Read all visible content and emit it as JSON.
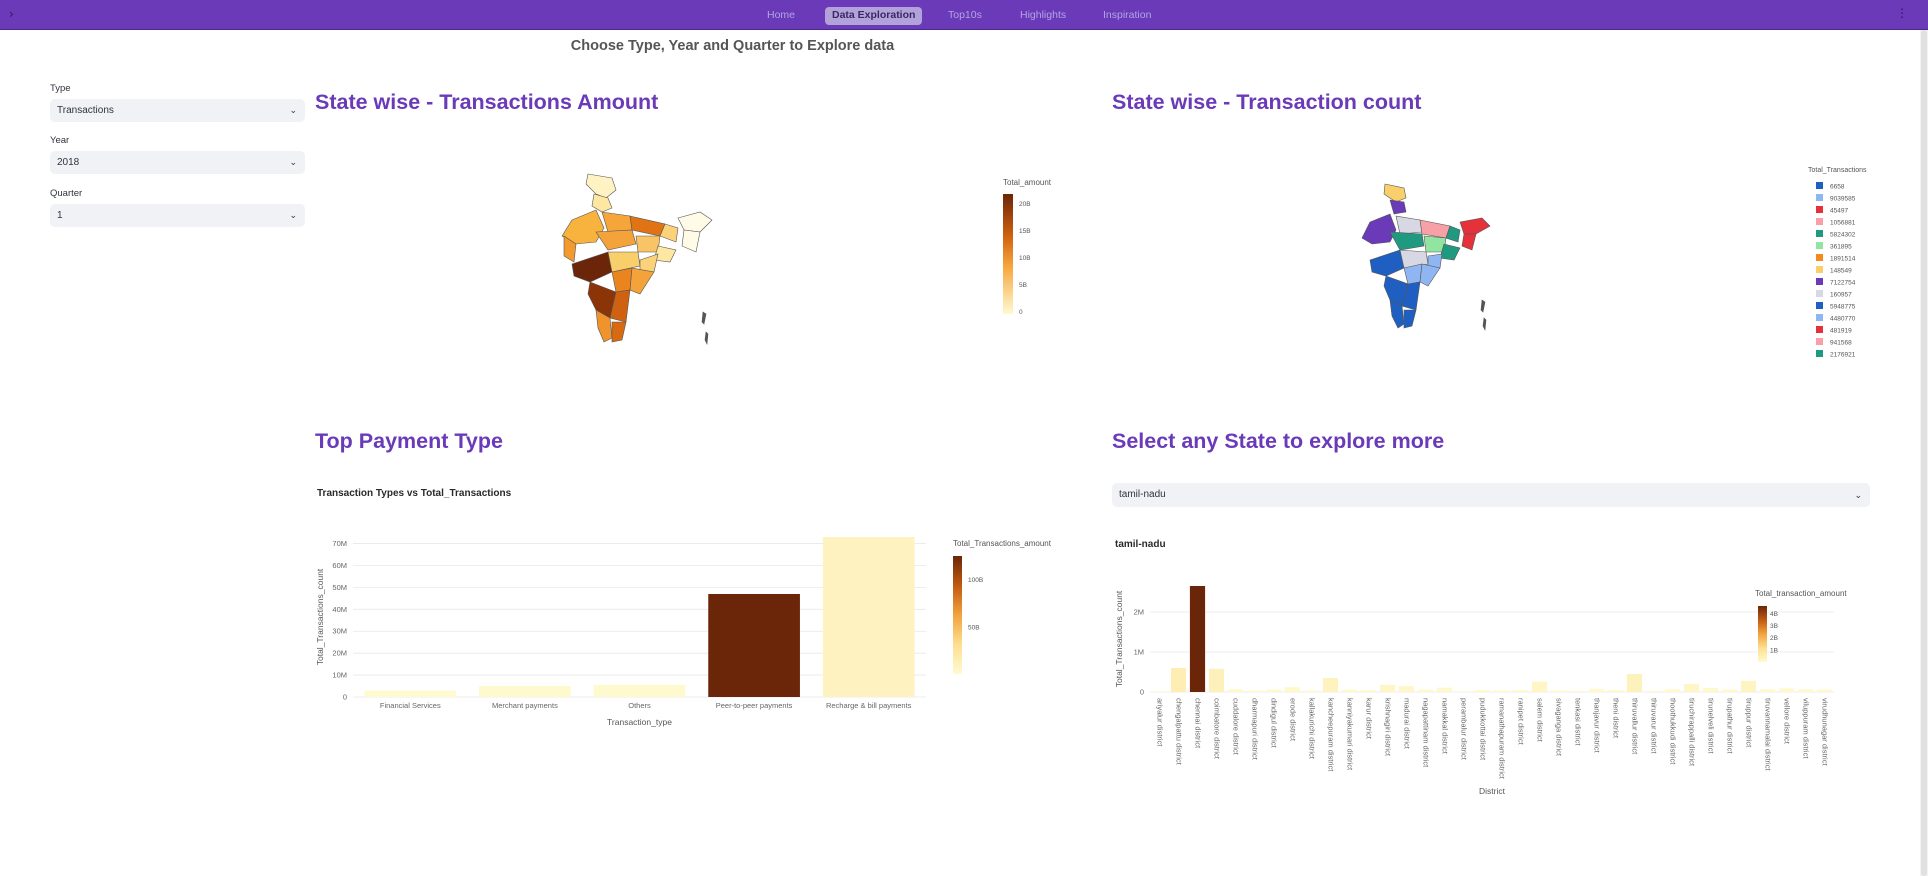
{
  "nav": {
    "toggle_icon": "chevron-right-icon",
    "menu_icon": "kebab-menu-icon",
    "items": [
      "Home",
      "Data Exploration",
      "Top10s",
      "Highlights",
      "Inspiration"
    ],
    "active_index": 1
  },
  "page": {
    "title": "Choose Type, Year and Quarter to Explore data"
  },
  "sidebar": {
    "type_label": "Type",
    "type_value": "Transactions",
    "year_label": "Year",
    "year_value": "2018",
    "quarter_label": "Quarter",
    "quarter_value": "1"
  },
  "sections": {
    "amount_title": "State wise - Transactions Amount",
    "count_title": "State wise - Transaction count",
    "payment_title": "Top Payment Type",
    "state_title": "Select any State to explore more",
    "state_select_value": "tamil-nadu"
  },
  "colors": {
    "accent": "#6a3ab9",
    "scale_high": "#6b2508",
    "scale_low": "#fffad0"
  },
  "maps": {
    "amount_map": {
      "colorbar_title": "Total_amount",
      "ticks": [
        "20B",
        "15B",
        "10B",
        "5B",
        "0"
      ]
    },
    "count_map": {
      "legend_title": "Total_Transactions",
      "entries": [
        {
          "label": "6658",
          "color": "#1f5fc2"
        },
        {
          "label": "9039585",
          "color": "#8fb6f2"
        },
        {
          "label": "45497",
          "color": "#e4313a"
        },
        {
          "label": "1056881",
          "color": "#f7a1a6"
        },
        {
          "label": "5824302",
          "color": "#1f9a80"
        },
        {
          "label": "361895",
          "color": "#91e5a1"
        },
        {
          "label": "1891514",
          "color": "#f28a1e"
        },
        {
          "label": "148549",
          "color": "#f9cf6b"
        },
        {
          "label": "7122754",
          "color": "#6a3ab9"
        },
        {
          "label": "160957",
          "color": "#d8d8e4"
        },
        {
          "label": "5948775",
          "color": "#1f5fc2"
        },
        {
          "label": "4480770",
          "color": "#8fb6f2"
        },
        {
          "label": "481919",
          "color": "#e4313a"
        },
        {
          "label": "941568",
          "color": "#f7a1a6"
        },
        {
          "label": "2176921",
          "color": "#1f9a80"
        }
      ]
    }
  },
  "chart_data": [
    {
      "type": "bar",
      "title": "Transaction Types vs Total_Transactions",
      "xlabel": "Transaction_type",
      "ylabel": "Total_Transactions_count",
      "categories": [
        "Financial Services",
        "Merchant payments",
        "Others",
        "Peer-to-peer payments",
        "Recharge & bill payments"
      ],
      "values": [
        3000000,
        5000000,
        5500000,
        47000000,
        73000000
      ],
      "color_values": [
        0.3,
        0.8,
        0.9,
        125,
        8
      ],
      "ylim": [
        0,
        73000000
      ],
      "yticks": [
        0,
        10000000,
        20000000,
        30000000,
        40000000,
        50000000,
        60000000,
        70000000
      ],
      "ytick_labels": [
        "0",
        "10M",
        "20M",
        "30M",
        "40M",
        "50M",
        "60M",
        "70M"
      ],
      "colorbar": {
        "title": "Total_Transactions_amount",
        "max": 125,
        "ticks": [
          100,
          50
        ],
        "tick_labels": [
          "100B",
          "50B"
        ]
      },
      "grid": true
    },
    {
      "type": "bar",
      "title": "tamil-nadu",
      "xlabel": "District",
      "ylabel": "Total_Transactions_count",
      "categories": [
        "ariyalur district",
        "chengalpattu district",
        "chennai district",
        "coimbatore district",
        "cuddalore district",
        "dharmapuri district",
        "dindigul district",
        "erode district",
        "kallakurichi district",
        "kancheepuram district",
        "kanniyakumari district",
        "karur district",
        "krishnagiri district",
        "madurai district",
        "nagapattinam district",
        "namakkal district",
        "perambalur district",
        "pudukkottai district",
        "ramanathapuram district",
        "ranipet district",
        "salem district",
        "sivaganga district",
        "tenkasi district",
        "thanjavur district",
        "theni district",
        "thiruvallur district",
        "thiruvarur district",
        "thoothukkudi district",
        "tiruchirappalli district",
        "tirunelveli district",
        "tirupathur district",
        "tiruppur district",
        "tiruvannamalai district",
        "vellore district",
        "viluppuram district",
        "virudhunagar district"
      ],
      "values": [
        20000,
        600000,
        2650000,
        580000,
        70000,
        40000,
        60000,
        120000,
        40000,
        350000,
        60000,
        50000,
        180000,
        150000,
        60000,
        110000,
        20000,
        50000,
        40000,
        50000,
        260000,
        40000,
        30000,
        80000,
        50000,
        450000,
        30000,
        70000,
        200000,
        100000,
        60000,
        280000,
        70000,
        90000,
        70000,
        60000
      ],
      "color_values": [
        0.05,
        0.5,
        4.6,
        0.4,
        0.05,
        0.03,
        0.04,
        0.1,
        0.03,
        0.3,
        0.04,
        0.04,
        0.15,
        0.12,
        0.04,
        0.08,
        0.02,
        0.04,
        0.03,
        0.04,
        0.2,
        0.03,
        0.02,
        0.06,
        0.04,
        0.35,
        0.02,
        0.05,
        0.15,
        0.08,
        0.04,
        0.25,
        0.05,
        0.07,
        0.05,
        0.04
      ],
      "ylim": [
        0,
        2650000
      ],
      "yticks": [
        0,
        1000000,
        2000000
      ],
      "ytick_labels": [
        "0",
        "1M",
        "2M"
      ],
      "colorbar": {
        "title": "Total_transaction_amount",
        "max": 4.6,
        "ticks": [
          4,
          3,
          2,
          1
        ],
        "tick_labels": [
          "4B",
          "3B",
          "2B",
          "1B"
        ]
      },
      "grid": true
    }
  ]
}
